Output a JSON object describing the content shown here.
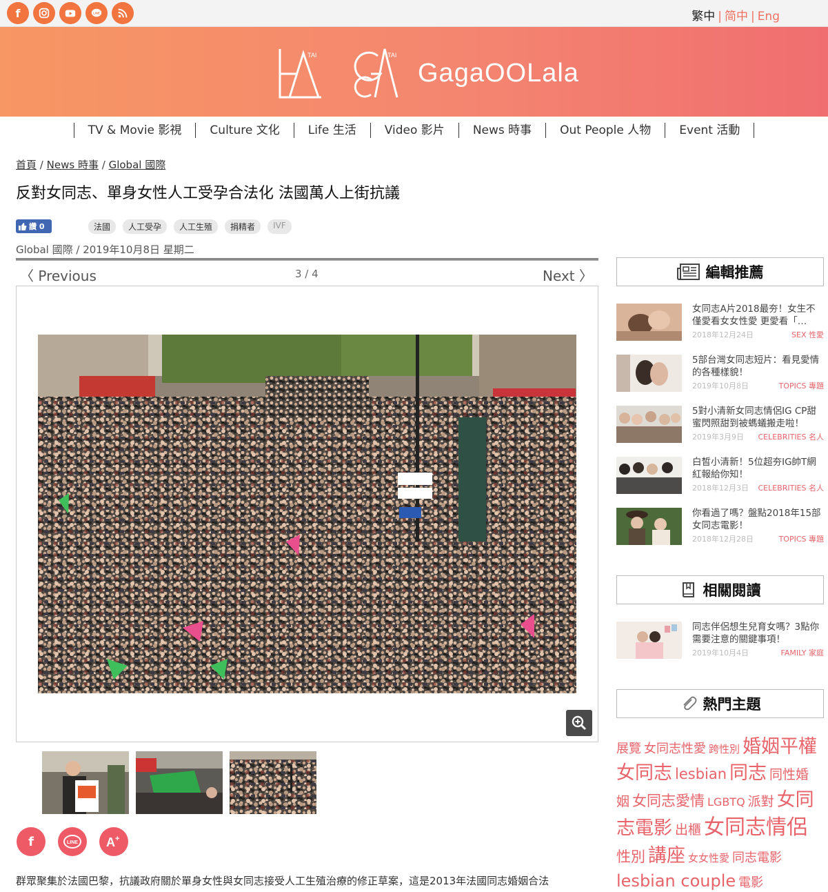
{
  "lang": {
    "active": "繁中",
    "simplified": "简中",
    "english": "Eng"
  },
  "brand": {
    "logo_text": "GagaOOLala",
    "la_small": "TAI",
    "ga_small": "TAI"
  },
  "nav": [
    {
      "label": "TV & Movie 影視"
    },
    {
      "label": "Culture 文化"
    },
    {
      "label": "Life 生活"
    },
    {
      "label": "Video 影片"
    },
    {
      "label": "News 時事"
    },
    {
      "label": "Out People 人物"
    },
    {
      "label": "Event 活動"
    }
  ],
  "breadcrumb": {
    "home": "首頁",
    "sep": "/",
    "section": "News 時事",
    "sub": "Global 國際"
  },
  "article": {
    "title": "反對女同志、單身女性人工受孕合法化 法國萬人上街抗議",
    "like_label": "讚 0",
    "tags": [
      "法國",
      "人工受孕",
      "人工生殖",
      "捐精者",
      "IVF"
    ],
    "meta": "Global 國際 / 2019年10月8日 星期二",
    "excerpt": "群眾聚集於法國巴黎，抗議政府關於單身女性與女同志接受人工生殖治療的修正草案，這是2013年法國同志婚姻合法"
  },
  "gallery": {
    "prev": "〈 Previous",
    "next": "Next 〉",
    "counter": "3 / 4"
  },
  "sidebar": {
    "editor_title": "編輯推薦",
    "related_title": "相關閱讀",
    "topics_title": "熱門主題",
    "editor_items": [
      {
        "title": "女同志A片2018最夯！女生不僅愛看女女性愛 更愛看「…",
        "date": "2018年12月24日",
        "category": "SEX 性愛"
      },
      {
        "title": "5部台灣女同志短片：看見愛情的各種樣貌！",
        "date": "2019年10月8日",
        "category": "TOPICS 專題"
      },
      {
        "title": "5對小清新女同志情侶IG CP甜蜜閃照甜到被螞蟻搬走啦！",
        "date": "2019年3月9日",
        "category": "CELEBRITIES 名人"
      },
      {
        "title": "白皙小清新！5位超夯IG帥T網紅報給你知！",
        "date": "2018年12月3日",
        "category": "CELEBRITIES 名人"
      },
      {
        "title": "你看過了嗎？盤點2018年15部女同志電影！",
        "date": "2018年12月28日",
        "category": "TOPICS 專題"
      }
    ],
    "related_items": [
      {
        "title": "同志伴侶想生兒育女嗎？3點你需要注意的關鍵事項！",
        "date": "2019年10月4日",
        "category": "FAMILY 家庭"
      }
    ],
    "topics": [
      {
        "label": "展覽",
        "size": 18
      },
      {
        "label": "女同志性愛",
        "size": 18
      },
      {
        "label": "跨性別",
        "size": 15
      },
      {
        "label": "婚姻平權",
        "size": 27
      },
      {
        "label": "女同志",
        "size": 27
      },
      {
        "label": "lesbian",
        "size": 21
      },
      {
        "label": "同志",
        "size": 27
      },
      {
        "label": "同性婚姻",
        "size": 19
      },
      {
        "label": "女同志愛情",
        "size": 21
      },
      {
        "label": "LGBTQ",
        "size": 16
      },
      {
        "label": "派對",
        "size": 19
      },
      {
        "label": "女同志電影",
        "size": 27
      },
      {
        "label": "出櫃",
        "size": 19
      },
      {
        "label": "女同志情侶",
        "size": 30
      },
      {
        "label": "性別",
        "size": 21
      },
      {
        "label": "講座",
        "size": 27
      },
      {
        "label": "女女性愛",
        "size": 15
      },
      {
        "label": "同志電影",
        "size": 18
      },
      {
        "label": "lesbian couple",
        "size": 24
      },
      {
        "label": "電影",
        "size": 18
      }
    ]
  }
}
